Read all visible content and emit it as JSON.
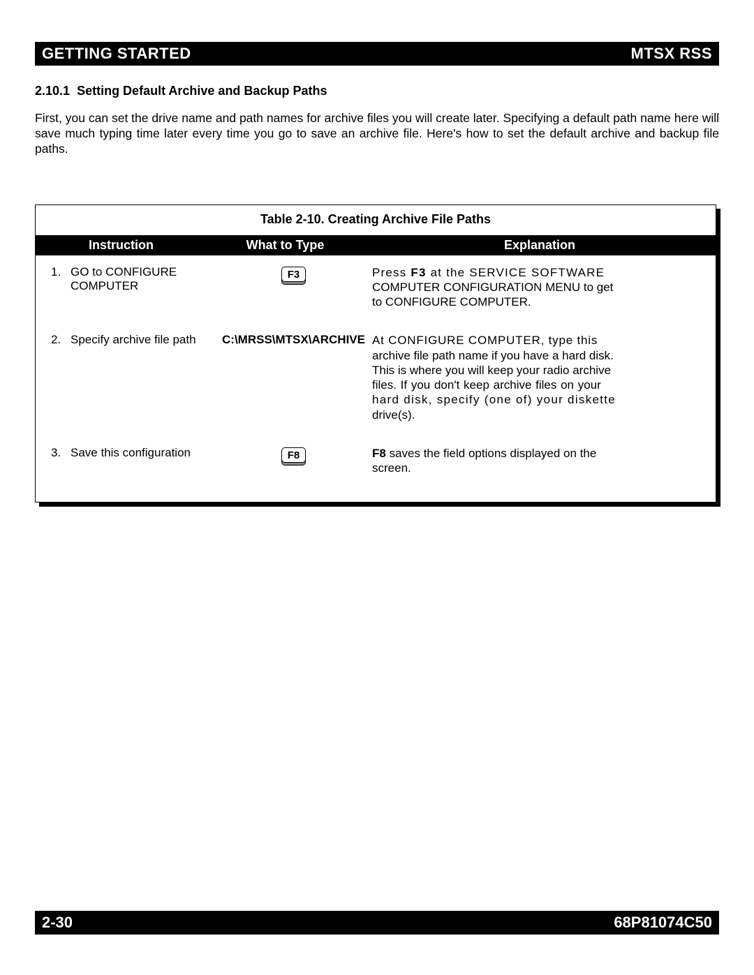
{
  "header": {
    "left": "GETTING STARTED",
    "right": "MTSX RSS"
  },
  "section": {
    "number": "2.10.1",
    "title": "Setting Default Archive and Backup Paths"
  },
  "intro": "First, you can set the drive name and path names for archive files you will create later. Specifying a default path name here will save much typing time later every time you go to save an archive file. Here's how to set the default archive and backup file paths.",
  "table": {
    "caption": "Table 2-10.  Creating Archive File Paths",
    "headers": {
      "instruction": "Instruction",
      "what": "What to Type",
      "explanation": "Explanation"
    },
    "rows": {
      "r1": {
        "num": "1.",
        "instruction_l1": "GO to CONFIGURE",
        "instruction_l2": "COMPUTER",
        "key": "F3",
        "exp_pre": "Press ",
        "exp_key": "F3",
        "exp_post1": " at the SERVICE SOFTWARE",
        "exp_l2": "COMPUTER CONFIGURATION MENU to get",
        "exp_l3": "to CONFIGURE COMPUTER."
      },
      "r2": {
        "num": "2.",
        "instruction": "Specify archive file path",
        "path": "C:\\MRSS\\MTSX\\ARCHIVE",
        "exp_l1": "At CONFIGURE COMPUTER, type this",
        "exp_l2": "archive file path name if you have a hard disk.",
        "exp_l3": "This is where you will keep your radio archive",
        "exp_l4": "files. If you don't keep archive files on your",
        "exp_l5": "hard disk, specify (one of) your diskette",
        "exp_l6": "drive(s)."
      },
      "r3": {
        "num": "3.",
        "instruction": "Save this configuration",
        "key": "F8",
        "exp_key": "F8",
        "exp_text1": " saves the field options displayed on ",
        "exp_text2": "the",
        "exp_l2": "screen."
      }
    }
  },
  "footer": {
    "left": "2-30",
    "right": "68P81074C50"
  }
}
